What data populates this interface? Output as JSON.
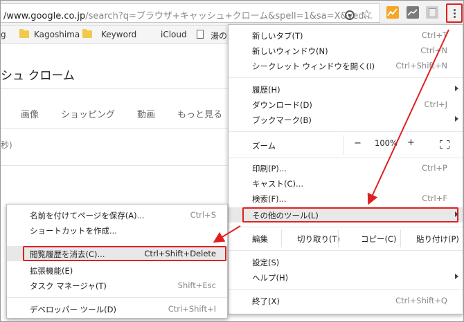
{
  "omnibox": {
    "url_host": "/www.google.co.jp",
    "url_rest": "/search?q=ブラウザ+キャッシュ+クローム&spell=1&sa=X&ved..."
  },
  "bookmarks": [
    {
      "label": "g"
    },
    {
      "label": "Kagoshima"
    },
    {
      "label": "Keyword"
    },
    {
      "label": "iCloud"
    },
    {
      "label": "湯の"
    }
  ],
  "page": {
    "query": "シュ クローム",
    "tabs": [
      "画像",
      "ショッピング",
      "動画",
      "もっと見る"
    ],
    "stats": "秒)"
  },
  "menu": {
    "new_tab": {
      "label": "新しいタブ(T)",
      "shortcut": "Ctrl+T"
    },
    "new_window": {
      "label": "新しいウィンドウ(N)",
      "shortcut": "Ctrl+N"
    },
    "incognito": {
      "label": "シークレット ウィンドウを開く(I)",
      "shortcut": "Ctrl+Shift+N"
    },
    "history": {
      "label": "履歴(H)"
    },
    "downloads": {
      "label": "ダウンロード(D)",
      "shortcut": "Ctrl+J"
    },
    "bookmarks": {
      "label": "ブックマーク(B)"
    },
    "zoom": {
      "label": "ズーム",
      "minus": "−",
      "value": "100%",
      "plus": "+"
    },
    "print": {
      "label": "印刷(P)...",
      "shortcut": "Ctrl+P"
    },
    "cast": {
      "label": "キャスト(C)..."
    },
    "find": {
      "label": "検索(F)...",
      "shortcut": "Ctrl+F"
    },
    "more_tools": {
      "label": "その他のツール(L)"
    },
    "edit": {
      "label": "編集",
      "cut": "切り取り(T)",
      "copy": "コピー(C)",
      "paste": "貼り付け(P)"
    },
    "settings": {
      "label": "設定(S)"
    },
    "help": {
      "label": "ヘルプ(H)"
    },
    "exit": {
      "label": "終了(X)",
      "shortcut": "Ctrl+Shift+Q"
    }
  },
  "submenu": {
    "save_page": {
      "label": "名前を付けてページを保存(A)...",
      "shortcut": "Ctrl+S"
    },
    "create_shortcut": {
      "label": "ショートカットを作成..."
    },
    "clear_history": {
      "label": "閲覧履歴を消去(C)...",
      "shortcut": "Ctrl+Shift+Delete"
    },
    "extensions": {
      "label": "拡張機能(E)"
    },
    "task_manager": {
      "label": "タスク マネージャ(T)",
      "shortcut": "Shift+Esc"
    },
    "dev_tools": {
      "label": "デベロッパー ツール(D)",
      "shortcut": "Ctrl+Shift+I"
    }
  },
  "colors": {
    "annotation_red": "#e02020",
    "highlight": "#e8e8e8"
  }
}
